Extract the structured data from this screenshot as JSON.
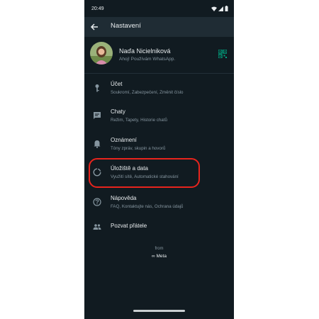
{
  "status_bar": {
    "time": "20:49"
  },
  "app_bar": {
    "title": "Nastavení"
  },
  "profile": {
    "name": "Naďa Nicielniková",
    "status": "Ahoj! Používám WhatsApp."
  },
  "settings": [
    {
      "title": "Účet",
      "subtitle": "Soukromí, Zabezpečení, Změnit číslo",
      "icon": "key-icon"
    },
    {
      "title": "Chaty",
      "subtitle": "Režim, Tapety, Historie chatů",
      "icon": "chat-icon"
    },
    {
      "title": "Oznámení",
      "subtitle": "Tóny zpráv, skupin a hovorů",
      "icon": "bell-icon"
    },
    {
      "title": "Úložiště a data",
      "subtitle": "Využití sítě, Automatické stahování",
      "icon": "data-usage-icon"
    },
    {
      "title": "Nápověda",
      "subtitle": "FAQ, Kontaktujte nás, Ochrana údajů",
      "icon": "help-icon"
    },
    {
      "title": "Pozvat přátele",
      "subtitle": "",
      "icon": "people-icon"
    }
  ],
  "footer": {
    "from": "from",
    "brand": "∞ Meta"
  },
  "colors": {
    "background": "#111b21",
    "app_bar": "#1f2c34",
    "accent": "#00a884",
    "highlight": "#e8241d"
  }
}
